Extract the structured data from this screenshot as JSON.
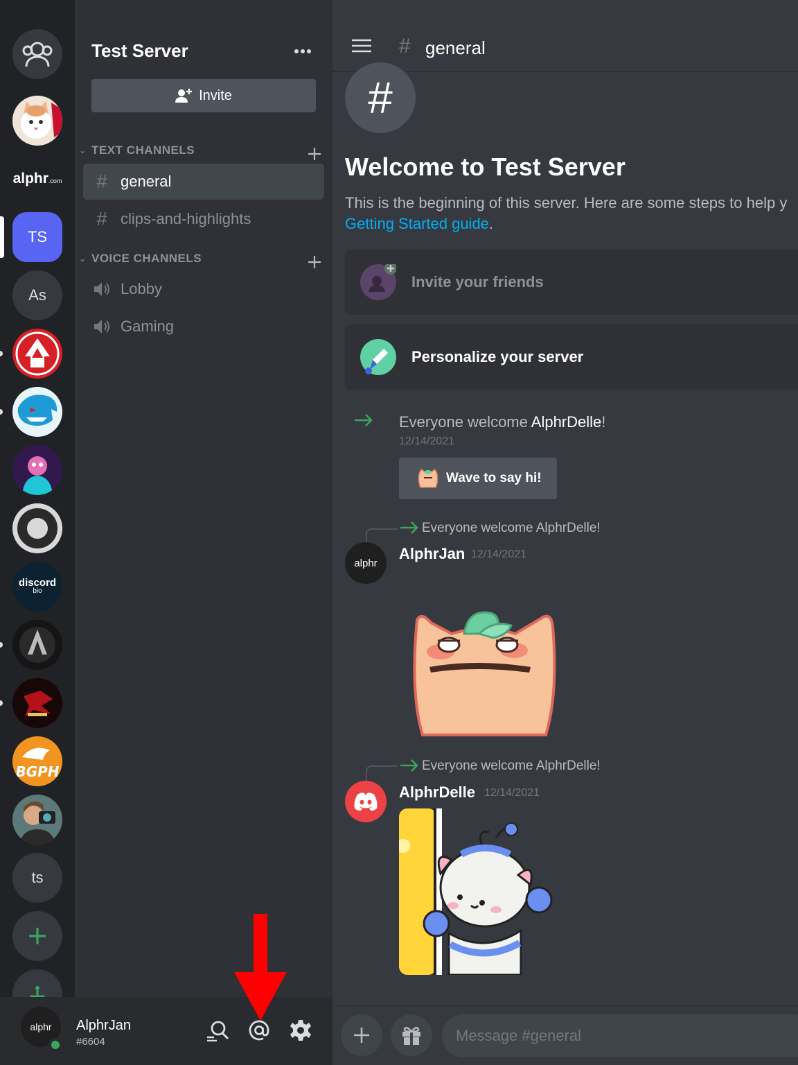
{
  "rail": {
    "alphr_logo": "alphr",
    "alphr_logo_suffix": ".com",
    "ts_active": "TS",
    "as": "As",
    "discord_bio_1": "discord",
    "discord_bio_2": "bio",
    "ts_lower": "ts"
  },
  "sidebar": {
    "server_name": "Test Server",
    "invite_label": "Invite",
    "text_channels_label": "TEXT CHANNELS",
    "voice_channels_label": "VOICE CHANNELS",
    "text_channels": [
      "general",
      "clips-and-highlights"
    ],
    "voice_channels": [
      "Lobby",
      "Gaming"
    ]
  },
  "user": {
    "avatar_text": "alphr",
    "name": "AlphrJan",
    "tag": "#6604"
  },
  "header": {
    "channel": "general"
  },
  "welcome": {
    "title": "Welcome to Test Server",
    "desc": "This is the beginning of this server. Here are some steps to help y",
    "link": "Getting Started guide",
    "link_suffix": ".",
    "card_invite": "Invite your friends",
    "card_personalize": "Personalize your server"
  },
  "messages": [
    {
      "prefix": "Everyone welcome ",
      "name": "AlphrDelle",
      "suffix": "!",
      "timestamp": "12/14/2021",
      "wave_label": "Wave to say hi!"
    },
    {
      "reply": "Everyone welcome AlphrDelle!",
      "author": "AlphrJan",
      "avatar_text": "alphr",
      "timestamp": "12/14/2021"
    },
    {
      "reply": "Everyone welcome AlphrDelle!",
      "author": "AlphrDelle",
      "timestamp": "12/14/2021"
    }
  ],
  "composer": {
    "placeholder": "Message #general"
  },
  "colors": {
    "accent": "#5865f2",
    "online": "#3ba55c",
    "link": "#00aff4",
    "annotation": "#ff0000"
  }
}
